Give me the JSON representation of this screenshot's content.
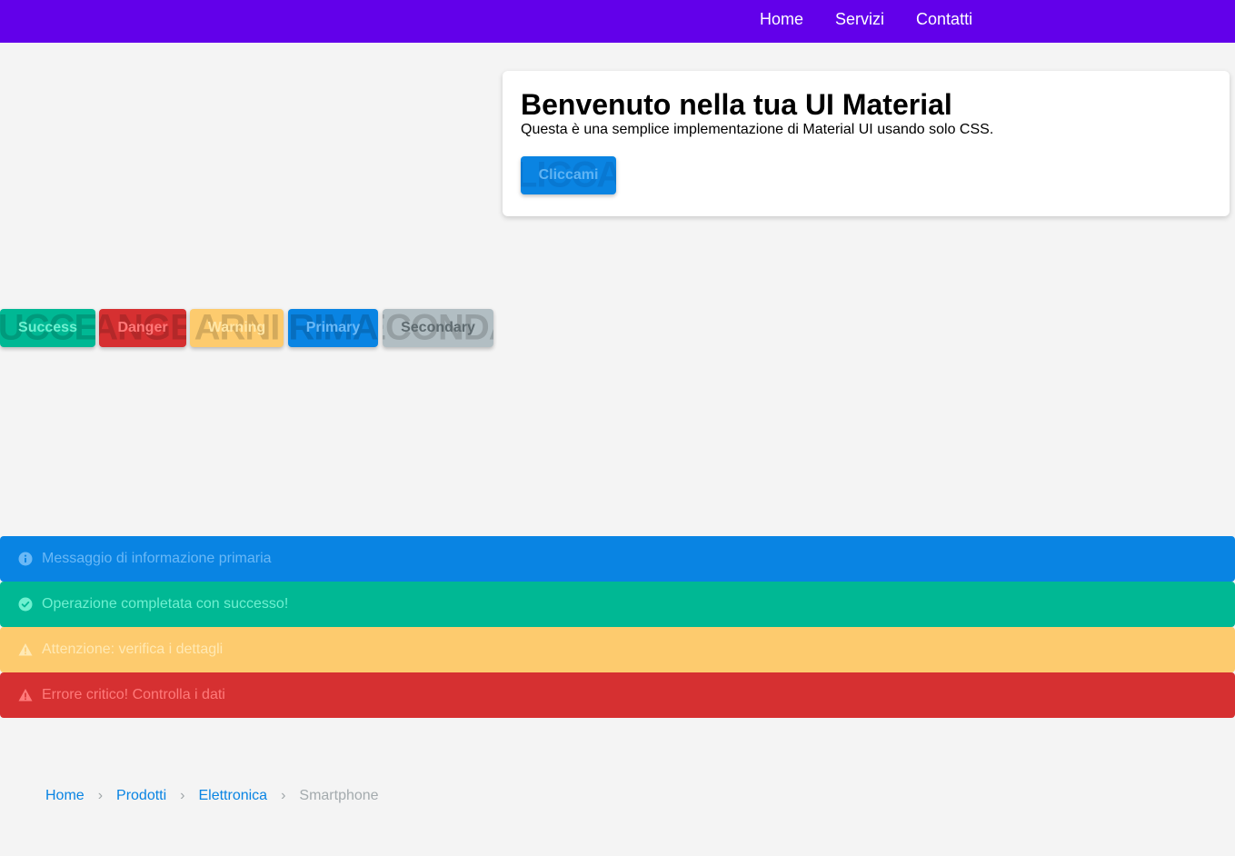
{
  "navbar": {
    "links": [
      {
        "label": "Home"
      },
      {
        "label": "Servizi"
      },
      {
        "label": "Contatti"
      }
    ]
  },
  "card": {
    "title": "Benvenuto nella tua UI Material",
    "text": "Questa è una semplice implementazione di Material UI usando solo CSS.",
    "button_label": "Cliccami",
    "button_ghost": "LICCA"
  },
  "buttons": [
    {
      "label": "Success",
      "ghost": "UCCE"
    },
    {
      "label": "Danger",
      "ghost": "ANGE"
    },
    {
      "label": "Warning",
      "ghost": "ARNI"
    },
    {
      "label": "Primary",
      "ghost": "RIMA"
    },
    {
      "label": "Secondary",
      "ghost": "ECONDA"
    }
  ],
  "alerts": [
    {
      "icon": "info-icon",
      "text": "Messaggio di informazione primaria"
    },
    {
      "icon": "check-circle-icon",
      "text": "Operazione completata con successo!"
    },
    {
      "icon": "warning-icon",
      "text": "Attenzione: verifica i dettagli"
    },
    {
      "icon": "warning-icon",
      "text": "Errore critico! Controlla i dati"
    }
  ],
  "breadcrumb": {
    "separator": "›",
    "items": [
      "Home",
      "Prodotti",
      "Elettronica"
    ],
    "current": "Smartphone"
  },
  "colors": {
    "navbar": "#6200ea",
    "primary": "#0984e3",
    "success": "#00b894",
    "danger": "#d63031",
    "warning": "#fdcb6e",
    "secondary": "#b2bec3"
  }
}
